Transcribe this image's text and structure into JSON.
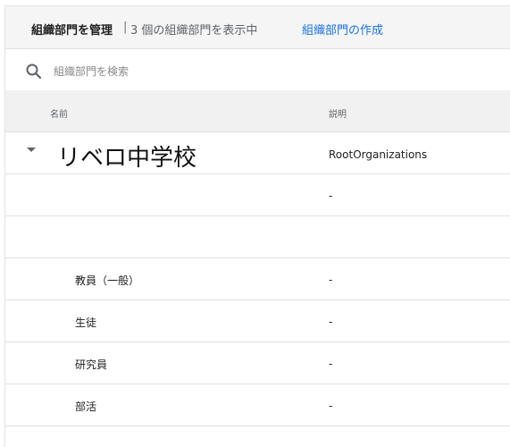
{
  "header": {
    "title": "組織部門を管理",
    "separator": "|",
    "count_text": "3 個の組織部門を表示中",
    "create_label": "組織部門の作成"
  },
  "search": {
    "placeholder": "組織部門を検索",
    "icon": "search-icon"
  },
  "table": {
    "columns": {
      "name": "名前",
      "description": "説明"
    },
    "root": {
      "name": "リベロ中学校",
      "description": "RootOrganizations",
      "expand_icon": "caret-down-icon"
    },
    "rows": [
      {
        "name": "",
        "description": "-"
      },
      {
        "name": "",
        "description": ""
      },
      {
        "name": "教員（一般）",
        "description": "-"
      },
      {
        "name": "生徒",
        "description": "-"
      },
      {
        "name": "研究員",
        "description": "-"
      },
      {
        "name": "部活",
        "description": "-"
      }
    ]
  },
  "colors": {
    "link": "#1a73e8",
    "header_bg": "#f5f5f5",
    "table_header_bg": "#f1f1f1",
    "divider": "#e0e0e0"
  }
}
